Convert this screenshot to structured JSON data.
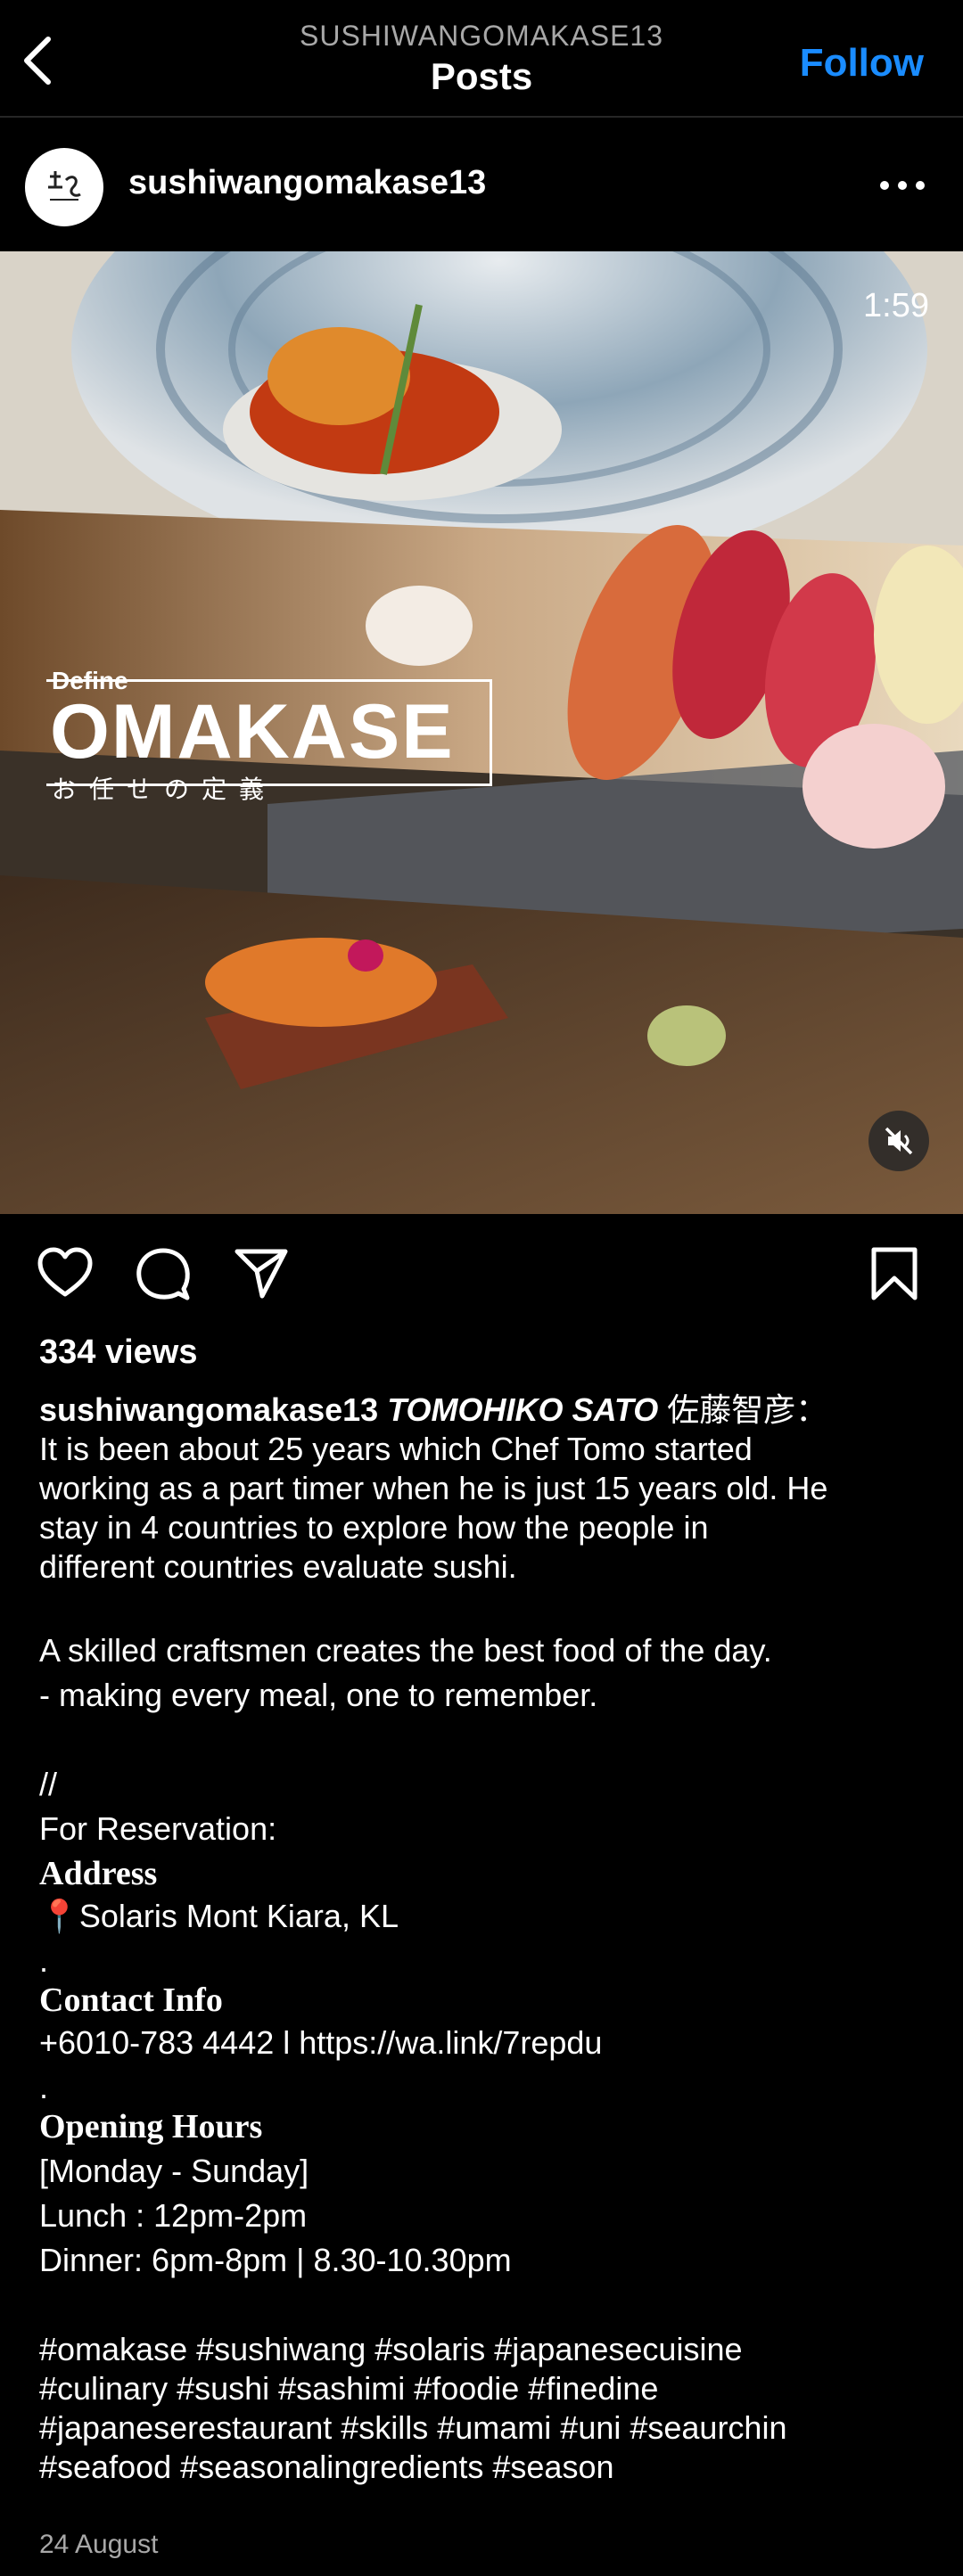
{
  "header": {
    "subtitle": "SUSHIWANGOMAKASE13",
    "title": "Posts",
    "follow_label": "Follow"
  },
  "post": {
    "username": "sushiwangomakase13",
    "video": {
      "timer": "1:59",
      "overlay_define": "Define",
      "overlay_title": "OMAKASE",
      "overlay_jp": "お任せの定義"
    },
    "views": "334 views",
    "caption": {
      "username": "sushiwangomakase13",
      "chef": "TOMOHIKO SATO",
      "chef_jp": "佐藤智彦：",
      "p1": [
        "It is been about 25 years which Chef Tomo started",
        "working as a part timer when he is just 15 years old. He",
        "stay in 4 countries to explore how the people in",
        "different countries evaluate sushi."
      ],
      "p2": [
        "A skilled craftsmen creates the best food of the day.",
        "- making every meal, one to remember."
      ],
      "slashes": "//",
      "reservation": "For Reservation:",
      "address_heading": "Address",
      "address": "📍Solaris Mont Kiara, KL",
      "dot1": ".",
      "contact_heading": "Contact Info",
      "contact": "+6010-783 4442 l https://wa.link/7repdu",
      "dot2": ".",
      "hours_heading": "Opening Hours",
      "days": "[Monday - Sunday]",
      "lunch": "Lunch : 12pm-2pm",
      "dinner": "Dinner: 6pm-8pm | 8.30-10.30pm",
      "hashtags": [
        "#omakase #sushiwang #solaris #japanesecuisine",
        "#culinary #sushi #sashimi #foodie #finedine",
        "#japaneserestaurant #skills #umami #uni #seaurchin",
        "#seafood #seasonalingredients #season"
      ]
    },
    "date": "24 August"
  },
  "icons": {
    "back": "chevron-left-icon",
    "more": "more-horizontal-icon",
    "like": "heart-icon",
    "comment": "comment-icon",
    "share": "send-icon",
    "save": "bookmark-icon",
    "mute": "speaker-muted-icon"
  },
  "colors": {
    "background": "#000000",
    "accent": "#1a8cff",
    "muted_text": "#a8a8a8"
  }
}
